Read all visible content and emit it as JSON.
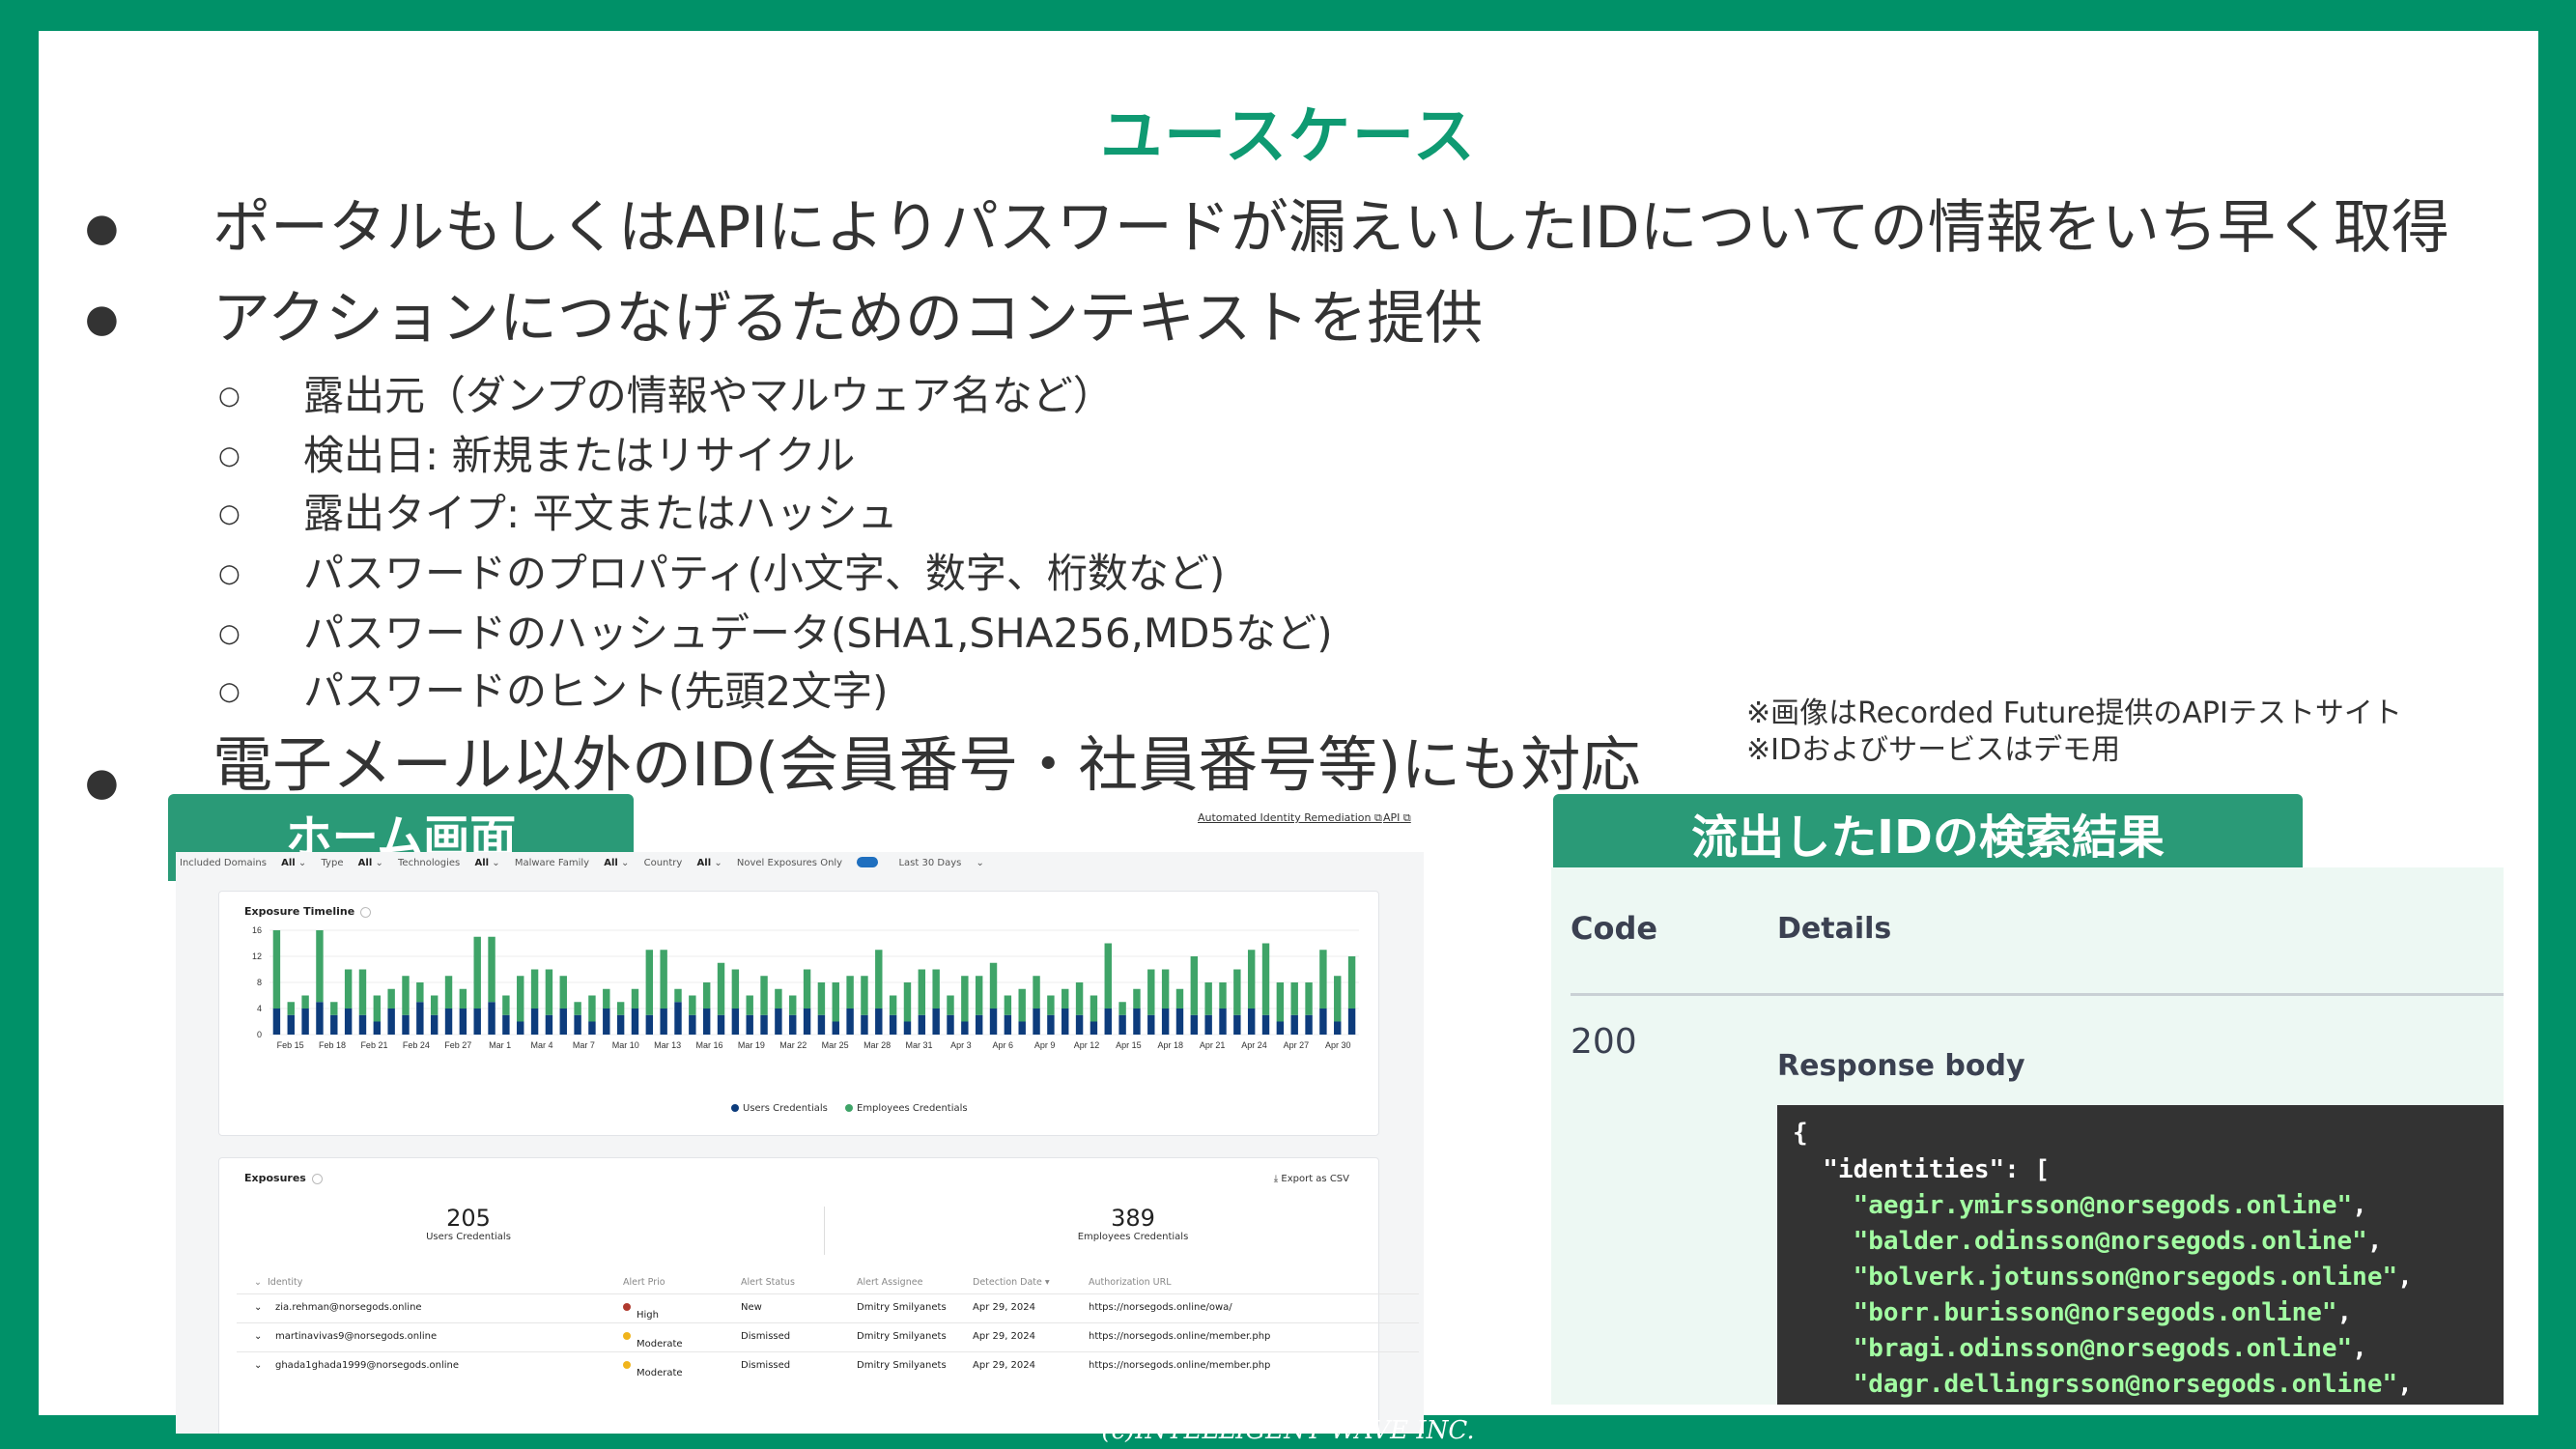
{
  "title": "ユースケース",
  "bullets": [
    "ポータルもしくはAPIによりパスワードが漏えいしたIDについての情報をいち早く取得",
    "アクションにつなげるためのコンテキストを提供"
  ],
  "sub_bullets": [
    "露出元（ダンプの情報やマルウェア名など）",
    "検出日: 新規またはリサイクル",
    "露出タイプ: 平文またはハッシュ",
    "パスワードのプロパティ(小文字、数字、桁数など)",
    "パスワードのハッシュデータ(SHA1,SHA256,MD5など)",
    "パスワードのヒント(先頭2文字)"
  ],
  "bullet3": "電子メール以外のID(会員番号・社員番号等)にも対応",
  "note": {
    "line1": "※画像はRecorded Future提供のAPIテストサイト",
    "line2": "※IDおよびサービスはデモ用"
  },
  "tab_home": "ホーム画面",
  "tab_results": "流出したIDの検索結果",
  "copyright": "(c)INTELLIGENT WAVE INC.",
  "dashboard": {
    "link_remediation": "Automated Identity Remediation",
    "link_api": "API",
    "filters": [
      {
        "label": "Included Domains",
        "value": "All"
      },
      {
        "label": "Type",
        "value": "All"
      },
      {
        "label": "Technologies",
        "value": "All"
      },
      {
        "label": "Malware Family",
        "value": "All"
      },
      {
        "label": "Country",
        "value": "All"
      }
    ],
    "novel_label": "Novel Exposures Only",
    "last_days": "Last 30 Days",
    "timeline_title": "Exposure Timeline",
    "exposures_title": "Exposures",
    "export_label": "Export as CSV",
    "users_count": "205",
    "users_label": "Users Credentials",
    "employees_count": "389",
    "employees_label": "Employees Credentials",
    "columns": [
      "Identity",
      "Alert Prio",
      "Alert Status",
      "Alert Assignee",
      "Detection Date",
      "Authorization URL"
    ],
    "rows": [
      {
        "identity": "zia.rehman@norsegods.online",
        "prio": "High",
        "prio_color": "#b03a2e",
        "status": "New",
        "assignee": "Dmitry Smilyanets",
        "date": "Apr 29, 2024",
        "url": "https://norsegods.online/owa/"
      },
      {
        "identity": "martinavivas9@norsegods.online",
        "prio": "Moderate",
        "prio_color": "#f0b41c",
        "status": "Dismissed",
        "assignee": "Dmitry Smilyanets",
        "date": "Apr 29, 2024",
        "url": "https://norsegods.online/member.php"
      },
      {
        "identity": "ghada1ghada1999@norsegods.online",
        "prio": "Moderate",
        "prio_color": "#f0b41c",
        "status": "Dismissed",
        "assignee": "Dmitry Smilyanets",
        "date": "Apr 29, 2024",
        "url": "https://norsegods.online/member.php"
      }
    ]
  },
  "chart_data": {
    "type": "bar",
    "stacked": true,
    "title": "Exposure Timeline",
    "ylim": [
      0,
      16
    ],
    "yticks": [
      0,
      4,
      8,
      12,
      16
    ],
    "xtick_labels": [
      "Feb 15",
      "Feb 18",
      "Feb 21",
      "Feb 24",
      "Feb 27",
      "Mar 1",
      "Mar 4",
      "Mar 7",
      "Mar 10",
      "Mar 13",
      "Mar 16",
      "Mar 19",
      "Mar 22",
      "Mar 25",
      "Mar 28",
      "Mar 31",
      "Apr 3",
      "Apr 6",
      "Apr 9",
      "Apr 12",
      "Apr 15",
      "Apr 18",
      "Apr 21",
      "Apr 24",
      "Apr 27",
      "Apr 30"
    ],
    "series": [
      {
        "name": "Users Credentials",
        "color": "#0d3c7c",
        "values": [
          4,
          3,
          4,
          5,
          3,
          4,
          3,
          2,
          4,
          3,
          5,
          3,
          4,
          4,
          4,
          5,
          3,
          2,
          4,
          3,
          4,
          3,
          2,
          4,
          3,
          4,
          3,
          4,
          5,
          3,
          4,
          3,
          4,
          3,
          3,
          4,
          3,
          4,
          3,
          2,
          4,
          3,
          4,
          3,
          2,
          3,
          4,
          3,
          2,
          3,
          4,
          3,
          2,
          4,
          3,
          4,
          3,
          2,
          4,
          3,
          4,
          3,
          4,
          4,
          3,
          3,
          4,
          3,
          4,
          3,
          2,
          3,
          3,
          4,
          2,
          4
        ]
      },
      {
        "name": "Employees Credentials",
        "color": "#3fa468",
        "values": [
          12,
          2,
          2,
          11,
          2,
          6,
          7,
          4,
          3,
          6,
          3,
          3,
          5,
          3,
          11,
          10,
          3,
          7,
          6,
          7,
          5,
          2,
          4,
          3,
          2,
          3,
          10,
          9,
          2,
          3,
          4,
          8,
          6,
          3,
          6,
          3,
          3,
          6,
          5,
          6,
          5,
          6,
          9,
          3,
          6,
          7,
          6,
          3,
          7,
          6,
          7,
          3,
          5,
          5,
          3,
          3,
          5,
          4,
          10,
          2,
          3,
          7,
          6,
          3,
          9,
          5,
          4,
          7,
          9,
          11,
          6,
          5,
          5,
          9,
          7,
          8
        ]
      }
    ]
  },
  "api": {
    "code_header": "Code",
    "details_header": "Details",
    "code_value": "200",
    "response_label": "Response body",
    "code_lines": [
      "{",
      "  \"identities\": [",
      "    \"aegir.ymirsson@norsegods.online\",",
      "    \"balder.odinsson@norsegods.online\",",
      "    \"bolverk.jotunsson@norsegods.online\",",
      "    \"borr.burisson@norsegods.online\",",
      "    \"bragi.odinsson@norsegods.online\",",
      "    \"dagr.dellingrsson@norsegods.online\","
    ]
  }
}
